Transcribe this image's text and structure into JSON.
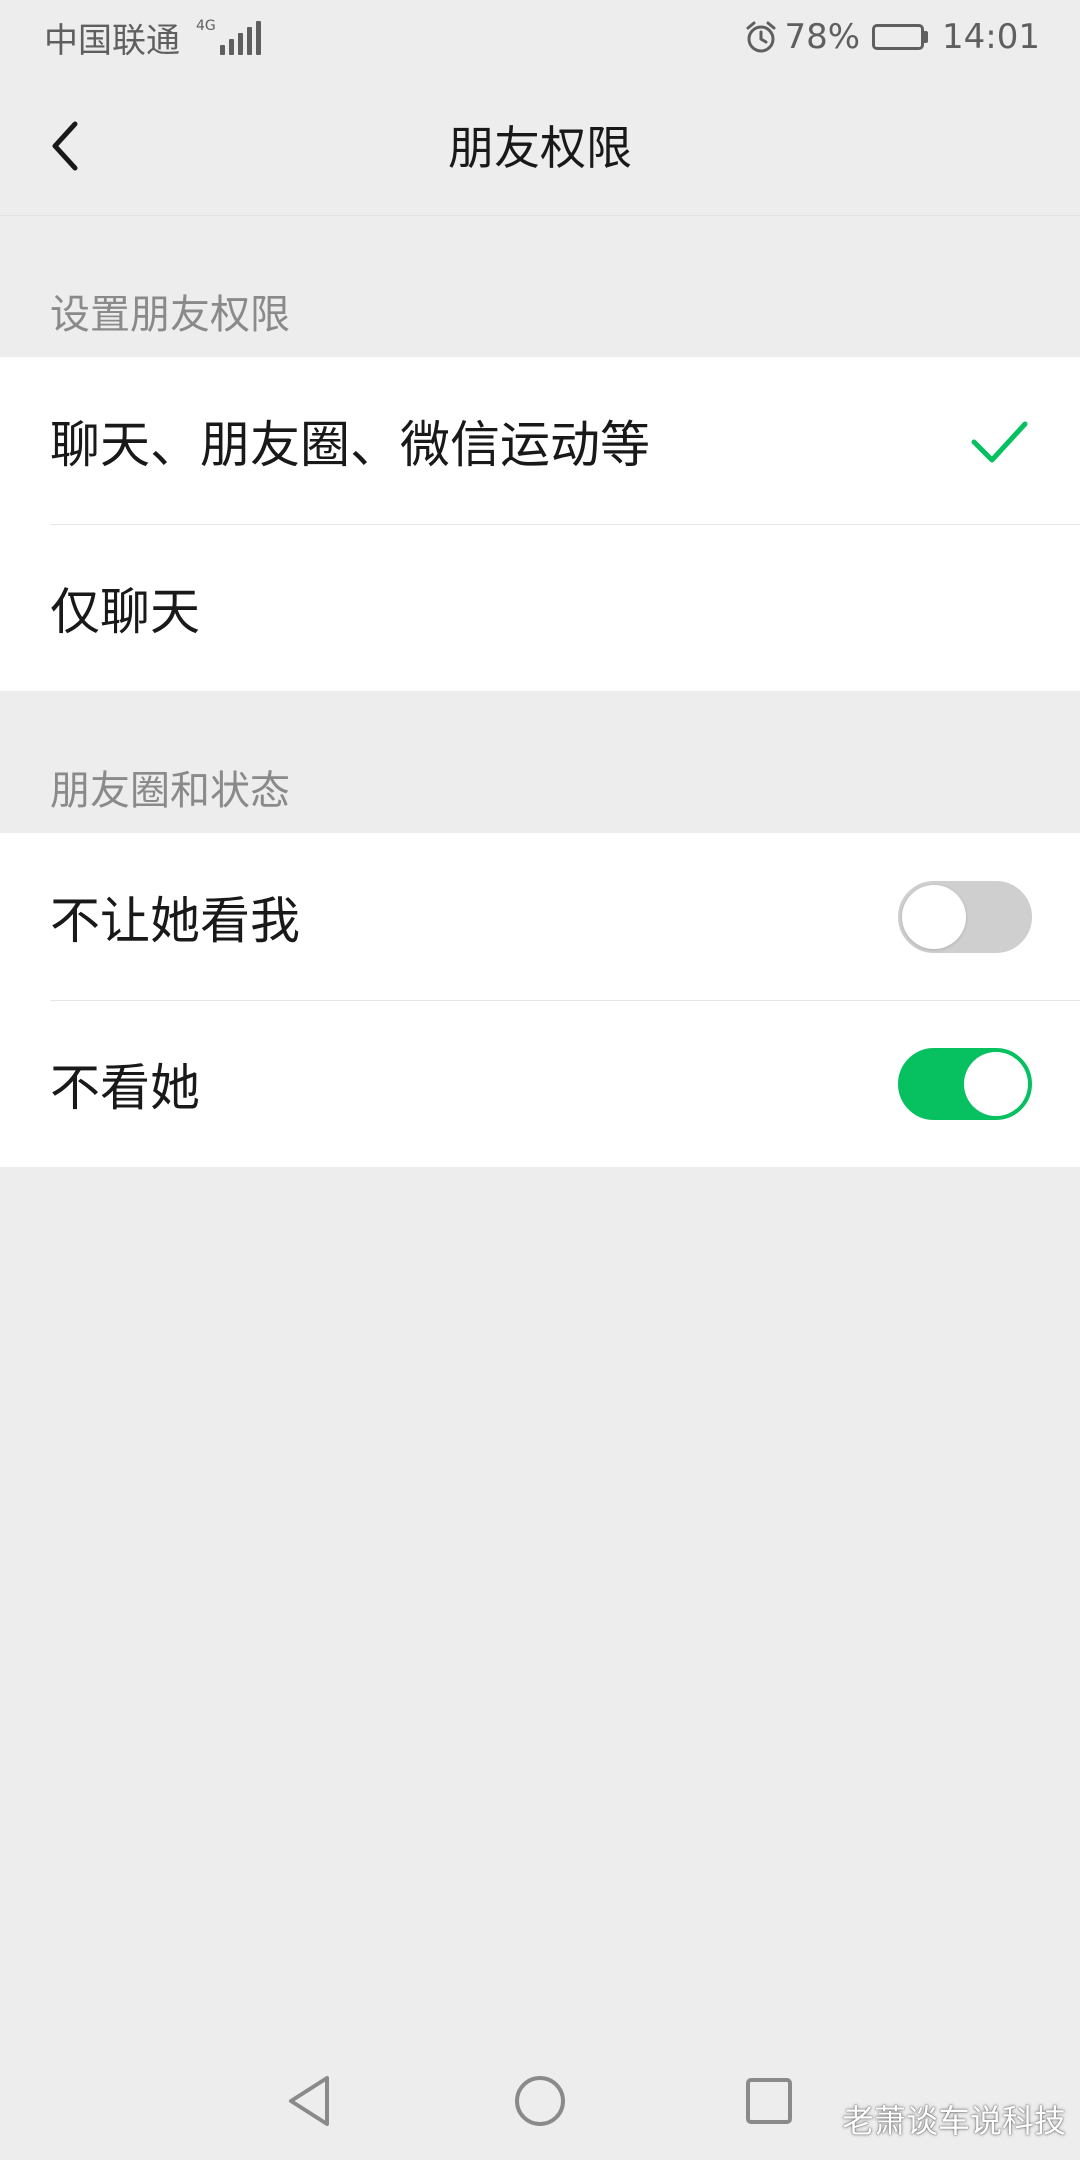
{
  "status_bar": {
    "carrier": "中国联通",
    "network": "4G",
    "battery_text": "78%",
    "battery_level": 0.78,
    "time": "14:01"
  },
  "nav": {
    "title": "朋友权限",
    "back_icon": "chevron-left-icon"
  },
  "sections": [
    {
      "header": "设置朋友权限",
      "items": [
        {
          "label": "聊天、朋友圈、微信运动等",
          "selected": true
        },
        {
          "label": "仅聊天",
          "selected": false
        }
      ]
    },
    {
      "header": "朋友圈和状态",
      "items": [
        {
          "label": "不让她看我",
          "toggle_on": false
        },
        {
          "label": "不看她",
          "toggle_on": true
        }
      ]
    }
  ],
  "system_nav": {
    "icons": [
      "triangle-back-icon",
      "circle-home-icon",
      "square-recents-icon"
    ]
  },
  "watermark": "老萧谈车说科技",
  "colors": {
    "accent": "#07c160",
    "background": "#ededed",
    "card": "#ffffff",
    "section_text": "#8a8a8a",
    "toggle_off": "#cfcfcf"
  }
}
